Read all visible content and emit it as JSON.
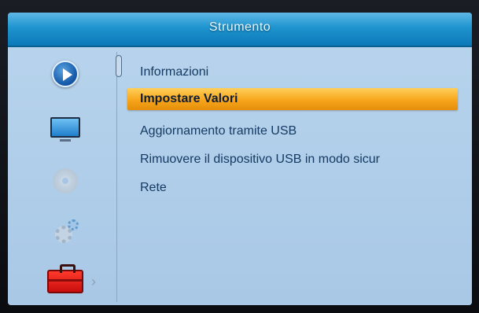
{
  "header": {
    "title": "Strumento"
  },
  "sidebar": {
    "icons": [
      {
        "name": "play-icon",
        "state": "normal"
      },
      {
        "name": "tv-icon",
        "state": "normal"
      },
      {
        "name": "disc-icon",
        "state": "dimmed"
      },
      {
        "name": "settings-gears-icon",
        "state": "dimmed"
      },
      {
        "name": "toolbox-icon",
        "state": "selected"
      }
    ],
    "selected_indicator": "›"
  },
  "menu": {
    "items": [
      {
        "label": "Informazioni",
        "selected": false
      },
      {
        "label": "Impostare Valori",
        "selected": true
      },
      {
        "label": "Aggiornamento tramite USB",
        "selected": false
      },
      {
        "label": "Rimuovere il dispositivo USB in modo sicur",
        "selected": false
      },
      {
        "label": "Rete",
        "selected": false
      }
    ]
  },
  "colors": {
    "title_bar": "#1e94cf",
    "panel": "#a8c8e6",
    "highlight": "#f7a51b",
    "text": "#153a63"
  }
}
